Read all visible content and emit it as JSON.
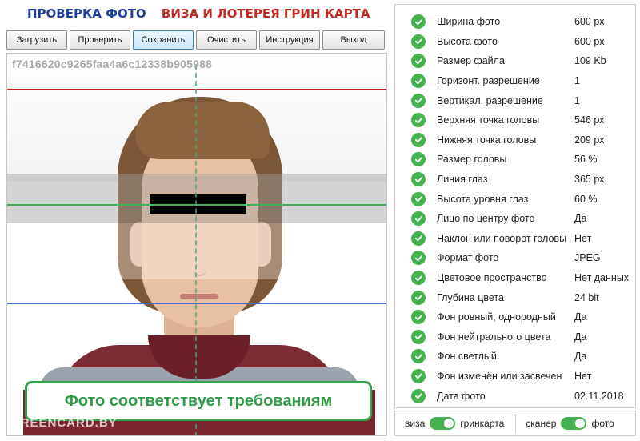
{
  "header": {
    "title_left": "ПРОВЕРКА ФОТО",
    "title_right": "ВИЗА И ЛОТЕРЕЯ ГРИН КАРТА"
  },
  "toolbar": {
    "load": "Загрузить",
    "check": "Проверить",
    "save": "Сохранить",
    "clear": "Очистить",
    "instructions": "Инструкция",
    "exit": "Выход"
  },
  "photo": {
    "hash": "f7416620c9265faa4a6c12338b905988",
    "result": "Фото соответствует требованиям",
    "watermark": "GREENCARD.BY"
  },
  "checks": [
    {
      "label": "Ширина фото",
      "value": "600 px"
    },
    {
      "label": "Высота фото",
      "value": "600 px"
    },
    {
      "label": "Размер файла",
      "value": "109 Kb"
    },
    {
      "label": "Горизонт. разрешение",
      "value": "1"
    },
    {
      "label": "Вертикал. разрешение",
      "value": "1"
    },
    {
      "label": "Верхняя точка головы",
      "value": "546 px"
    },
    {
      "label": "Нижняя точка головы",
      "value": "209 px"
    },
    {
      "label": "Размер головы",
      "value": "56 %"
    },
    {
      "label": "Линия глаз",
      "value": "365 px"
    },
    {
      "label": "Высота уровня глаз",
      "value": "60 %"
    },
    {
      "label": "Лицо по центру фото",
      "value": "Да"
    },
    {
      "label": "Наклон или поворот головы",
      "value": "Нет"
    },
    {
      "label": "Формат фото",
      "value": "JPEG"
    },
    {
      "label": "Цветовое пространство",
      "value": "Нет данных"
    },
    {
      "label": "Глубина цвета",
      "value": "24 bit"
    },
    {
      "label": "Фон ровный, однородный",
      "value": "Да"
    },
    {
      "label": "Фон нейтрального цвета",
      "value": "Да"
    },
    {
      "label": "Фон светлый",
      "value": "Да"
    },
    {
      "label": "Фон изменён или засвечен",
      "value": "Нет"
    },
    {
      "label": "Дата фото",
      "value": "02.11.2018"
    }
  ],
  "toggles": {
    "mode_left": "виза",
    "mode_right": "гринкарта",
    "source_left": "сканер",
    "source_right": "фото"
  },
  "colors": {
    "accent_green": "#45b24f",
    "title_blue": "#1f3f9c",
    "title_red": "#c42a22"
  }
}
